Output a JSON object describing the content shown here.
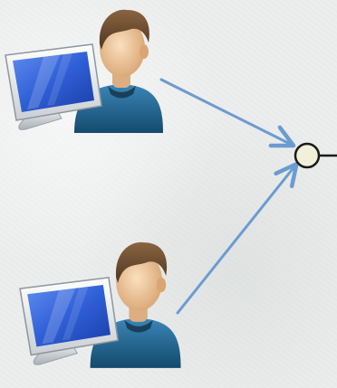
{
  "diagram": {
    "nodes": [
      {
        "id": "user-top",
        "icon": "user-workstation-icon"
      },
      {
        "id": "user-bottom",
        "icon": "user-workstation-icon"
      },
      {
        "id": "hub",
        "icon": "connection-node-icon"
      }
    ],
    "edges": [
      {
        "from": "user-top",
        "to": "hub"
      },
      {
        "from": "user-bottom",
        "to": "hub"
      }
    ],
    "colors": {
      "background": "#eceeed",
      "arrow": "#6b9bd1",
      "node_fill": "#f1f1da",
      "node_stroke": "#1a1a1a",
      "monitor_frame": "#e9ecee",
      "monitor_screen": "#2f5fd6",
      "shirt": "#1f5f86",
      "skin": "#efc79b",
      "hair": "#6b4a2f"
    }
  }
}
